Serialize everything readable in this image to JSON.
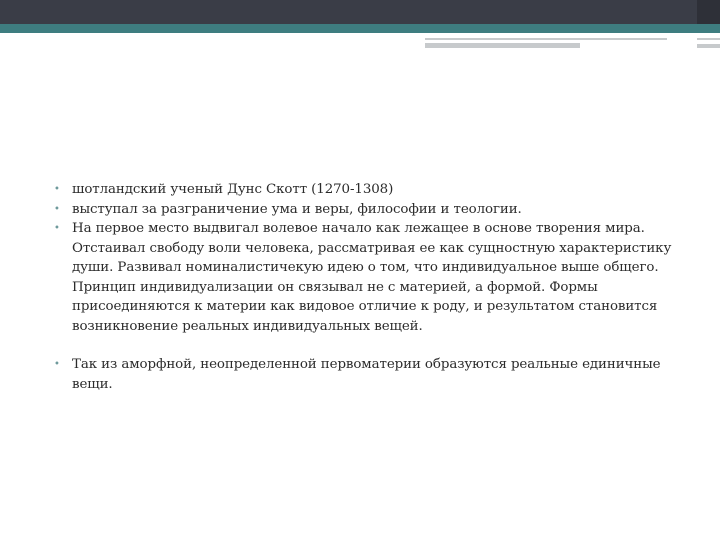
{
  "bullets": [
    "шотландский ученый Дунс Скотт (1270-1308)",
    "выступал за разграничение ума и веры, философии и теологии.",
    "На первое место выдвигал волевое начало как лежащее в основе творения мира. Отстаивал свободу воли человека, рассматривая ее как сущностную характеристику души. Развивал номиналистичекую идею о том, что индивидуальное выше общего. Принцип индивидуализации он связывал не с материей, а формой. Формы присоединяются к материи как видовое отличие к роду, и результатом становится возникновение реальных индивидуальных вещей.",
    "Так из аморфной, неопределенной первоматерии образуются реальные единичные вещи."
  ],
  "bullet_symbol": "•",
  "colors": {
    "top_bar": "#3a3d47",
    "accent_bar": "#3e7d80",
    "bullet": "#6f9a9c",
    "text": "#2b2b2b"
  }
}
